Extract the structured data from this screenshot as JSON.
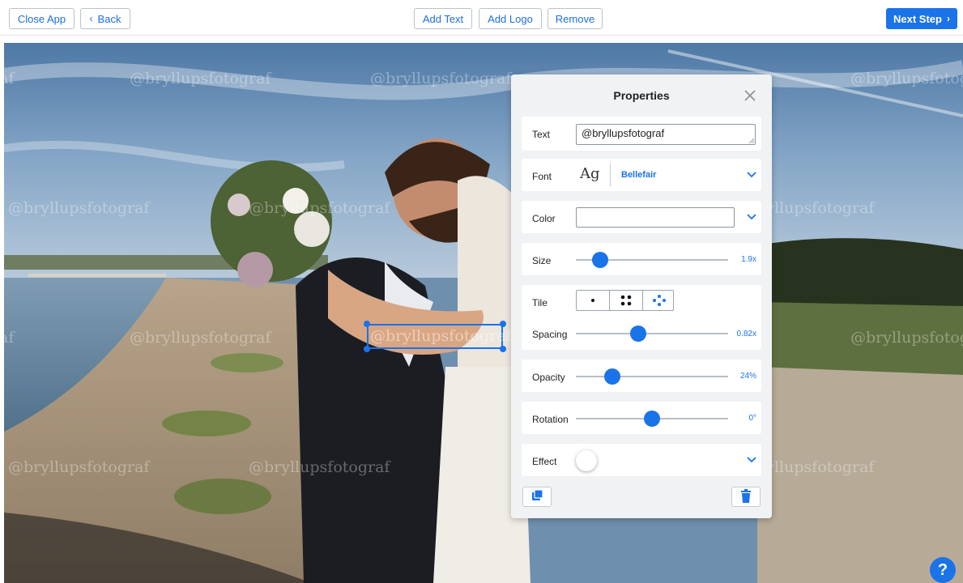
{
  "toolbar": {
    "close_app": "Close App",
    "back": "Back",
    "add_text": "Add Text",
    "add_logo": "Add Logo",
    "remove": "Remove",
    "next_step": "Next Step"
  },
  "watermark": {
    "text": "@bryllupsfotograf",
    "fragment_left": "af"
  },
  "properties": {
    "title": "Properties",
    "text_label": "Text",
    "text_value": "@bryllupsfotograf",
    "font_label": "Font",
    "font_preview": "Ag",
    "font_name": "Bellefair",
    "color_label": "Color",
    "color_value": "#ffffff",
    "size_label": "Size",
    "size_value": "1.9x",
    "size_fraction": 0.16,
    "tile_label": "Tile",
    "tile_options": [
      "single",
      "grid",
      "scatter"
    ],
    "spacing_label": "Spacing",
    "spacing_value": "0.82x",
    "spacing_fraction": 0.41,
    "opacity_label": "Opacity",
    "opacity_value": "24%",
    "opacity_fraction": 0.24,
    "rotation_label": "Rotation",
    "rotation_value": "0°",
    "rotation_fraction": 0.5,
    "effect_label": "Effect",
    "effect_enabled": false
  },
  "help": {
    "label": "?"
  },
  "colors": {
    "accent": "#1a73e8",
    "panel_bg": "#f1f2f4"
  }
}
